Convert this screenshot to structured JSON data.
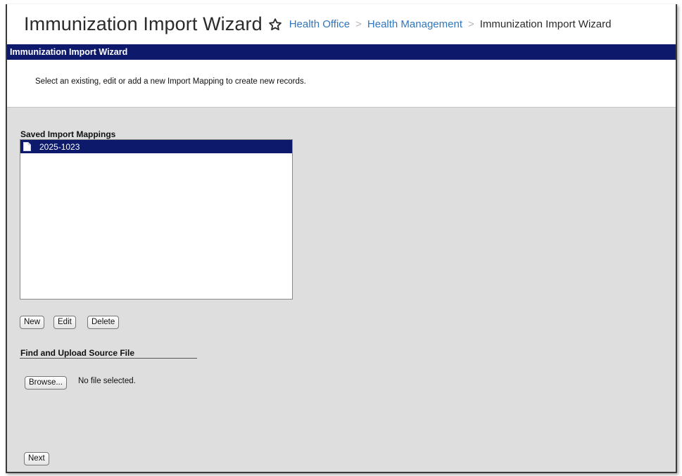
{
  "header": {
    "title": "Immunization Import Wizard",
    "breadcrumbs": [
      "Health Office",
      "Health Management",
      "Immunization Import Wizard"
    ]
  },
  "window": {
    "title": "Immunization Import Wizard",
    "instruction": "Select an existing, edit or add a new Import Mapping to create new records."
  },
  "saved_mappings": {
    "label": "Saved Import Mappings",
    "items": [
      {
        "label": "2025-1023",
        "selected": true
      }
    ],
    "buttons": {
      "new": "New",
      "edit": "Edit",
      "delete": "Delete"
    }
  },
  "upload": {
    "label": "Find and Upload Source File",
    "browse": "Browse...",
    "status": "No file selected."
  },
  "next": "Next",
  "colors": {
    "titlebar": "#0d1a6b",
    "link": "#2f76c0",
    "panel": "#dedede"
  },
  "icons": {
    "favorite": "star-outline-icon",
    "mapping": "document-icon"
  }
}
